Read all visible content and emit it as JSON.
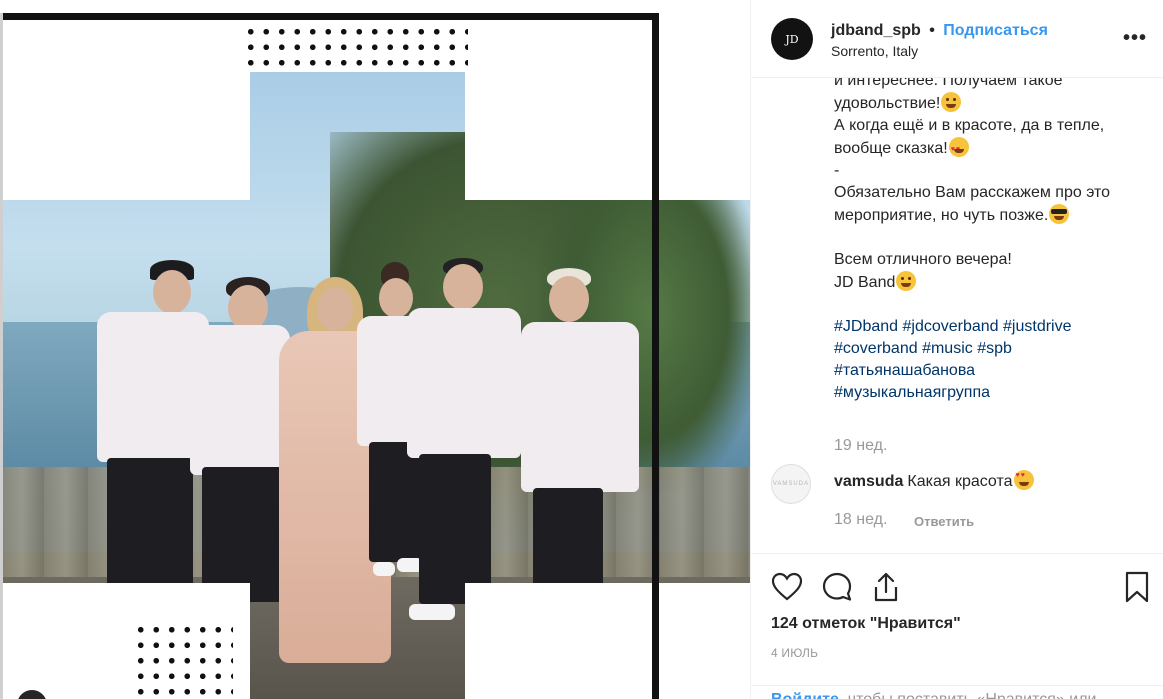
{
  "post": {
    "username": "jdband_spb",
    "separator": "•",
    "follow_label": "Подписаться",
    "location": "Sorrento, Italy",
    "more_label": "•••",
    "avatar_text": "JD"
  },
  "caption": {
    "lines": [
      "и интереснее. Получаем такое",
      "удовольствие!",
      "А когда ещё и в красоте, да в тепле,",
      "вообще сказка!",
      "-",
      "Обязательно Вам расскажем про это",
      "мероприятие, но чуть позже.",
      "Всем отличного вечера!",
      "JD Band"
    ],
    "hashtags": [
      "#JDband",
      "#jdcoverband",
      "#justdrive",
      "#coverband",
      "#music",
      "#spb",
      "#татьянашабанова",
      "#музыкальнаягруппа"
    ],
    "time": "19 нед."
  },
  "comment": {
    "username": "vamsuda",
    "text": "Какая красота",
    "time": "18 нед.",
    "reply_label": "Ответить",
    "avatar_text": "VAMSUDA"
  },
  "icons": {
    "like": "heart-icon",
    "comment": "comment-icon",
    "share": "share-icon",
    "save": "bookmark-icon",
    "emoji_wink": "wink-emoji",
    "emoji_love": "heart-eyes-emoji",
    "emoji_cool": "sunglasses-emoji",
    "emoji_blink": "smile-emoji"
  },
  "footer": {
    "likes": "124 отметок \"Нравится\"",
    "date": "4 июль",
    "login_link": "Войдите",
    "login_rest": ", чтобы поставить «Нравится» или"
  },
  "colors": {
    "link_blue": "#3897f0",
    "hashtag": "#003569",
    "muted": "#999999",
    "text": "#262626"
  }
}
